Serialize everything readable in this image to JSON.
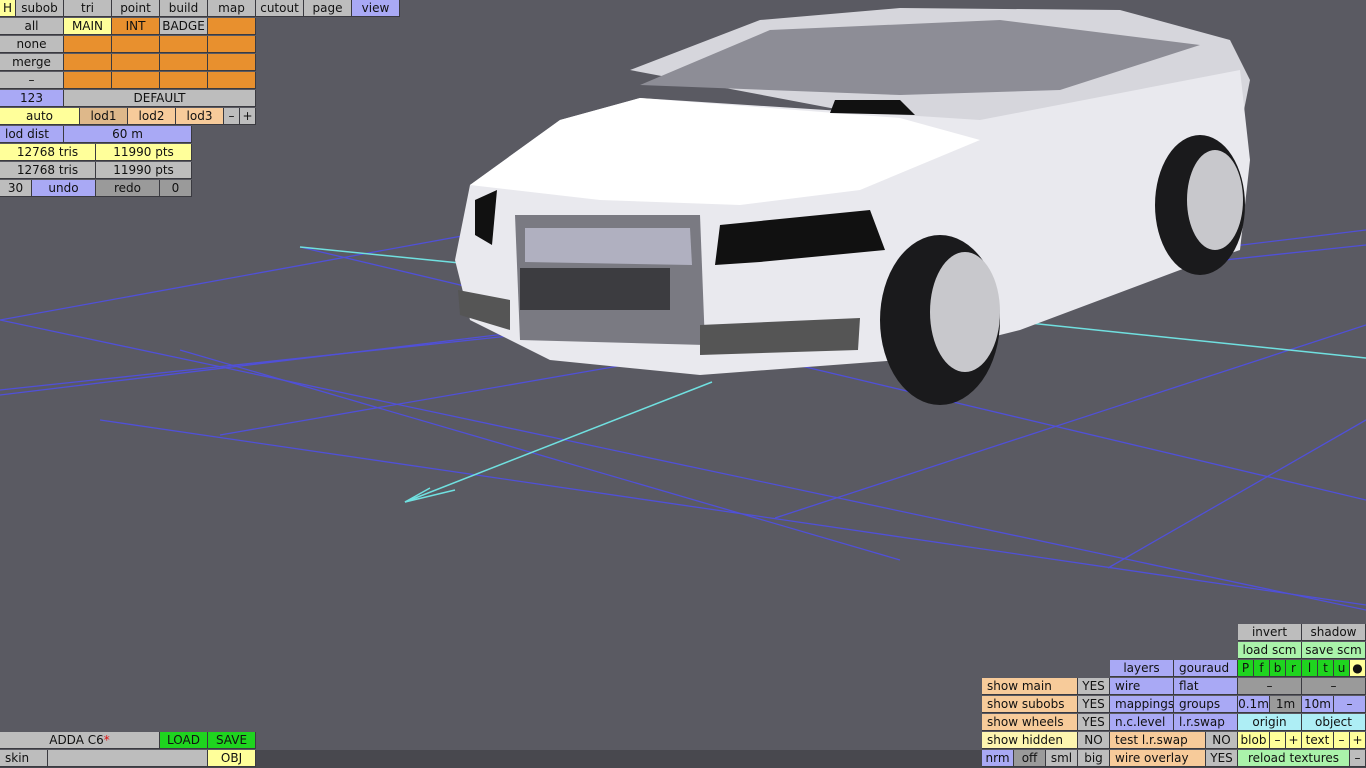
{
  "menu": {
    "h": "H",
    "subob": "subob",
    "tri": "tri",
    "point": "point",
    "build": "build",
    "map": "map",
    "cutout": "cutout",
    "page": "page",
    "view": "view"
  },
  "subobs": {
    "rows": [
      "all",
      "none",
      "merge",
      "–"
    ],
    "cols": [
      "MAIN",
      "INT",
      "BADGE"
    ]
  },
  "counter": "123",
  "default_label": "DEFAULT",
  "lod": {
    "auto": "auto",
    "lod1": "lod1",
    "lod2": "lod2",
    "lod3": "lod3",
    "minus": "–",
    "plus": "+",
    "dist_label": "lod dist",
    "dist_value": "60 m"
  },
  "stats": {
    "tris1": "12768 tris",
    "pts1": "11990 pts",
    "tris2": "12768 tris",
    "pts2": "11990 pts"
  },
  "undo": {
    "count": "30",
    "undo": "undo",
    "redo": "redo",
    "redo_count": "0"
  },
  "vehicle": {
    "name": "ADDA C6",
    "modified_mark": "*",
    "load": "LOAD",
    "save": "SAVE",
    "skin": "skin",
    "obj": "OBJ"
  },
  "view_panel": {
    "invert": "invert",
    "shadow": "shadow",
    "load_scm": "load scm",
    "save_scm": "save scm",
    "flags": [
      "P",
      "f",
      "b",
      "r",
      "l",
      "t",
      "u"
    ],
    "dot": "●",
    "layers": "layers",
    "gouraud": "gouraud",
    "wire": "wire",
    "flat": "flat",
    "dash": "–",
    "show_main": "show main",
    "show_main_v": "YES",
    "show_subobs": "show subobs",
    "show_subobs_v": "YES",
    "show_wheels": "show wheels",
    "show_wheels_v": "YES",
    "show_hidden": "show hidden",
    "show_hidden_v": "NO",
    "mappings": "mappings",
    "groups": "groups",
    "g01": "0.1m",
    "g1": "1m",
    "g10": "10m",
    "minus": "–",
    "nclevel": "n.c.level",
    "lrswap": "l.r.swap",
    "origin": "origin",
    "object": "object",
    "test_lrswap": "test l.r.swap",
    "test_lrswap_v": "NO",
    "blob": "blob",
    "plus": "+",
    "text": "text",
    "nrm": "nrm",
    "off": "off",
    "sml": "sml",
    "big": "big",
    "wire_overlay": "wire overlay",
    "wire_overlay_v": "YES",
    "reload": "reload textures"
  },
  "colors": {
    "background": "#5a5a62",
    "grid": "#5050d8",
    "axis": "#70e0e0",
    "car": "#e9e9ee"
  }
}
